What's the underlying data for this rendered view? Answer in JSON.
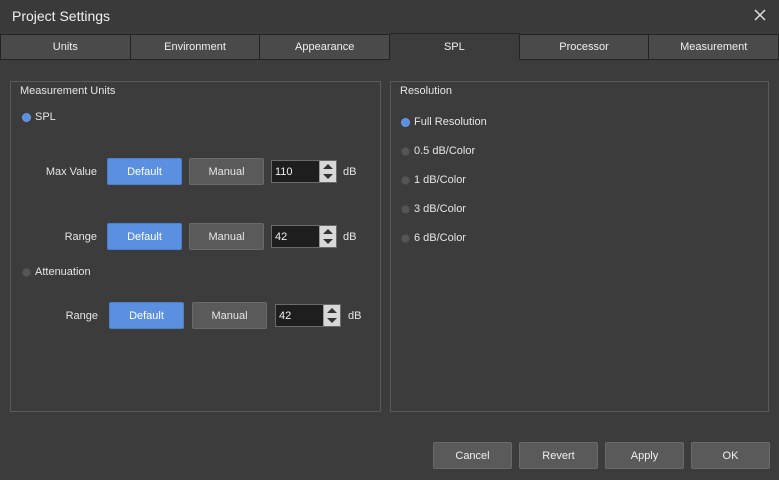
{
  "window": {
    "title": "Project Settings",
    "close_icon": "close-icon"
  },
  "tabs": [
    {
      "label": "Units"
    },
    {
      "label": "Environment"
    },
    {
      "label": "Appearance"
    },
    {
      "label": "SPL",
      "active": true
    },
    {
      "label": "Processor"
    },
    {
      "label": "Measurement"
    }
  ],
  "measurement_units": {
    "title": "Measurement Units",
    "spl_label": "SPL",
    "spl_selected": true,
    "max_value": {
      "label": "Max Value",
      "default_label": "Default",
      "manual_label": "Manual",
      "value": "110",
      "unit": "dB"
    },
    "spl_range": {
      "label": "Range",
      "default_label": "Default",
      "manual_label": "Manual",
      "value": "42",
      "unit": "dB"
    },
    "attenuation_label": "Attenuation",
    "attenuation_selected": false,
    "attenuation_range": {
      "label": "Range",
      "default_label": "Default",
      "manual_label": "Manual",
      "value": "42",
      "unit": "dB"
    }
  },
  "resolution": {
    "title": "Resolution",
    "options": [
      {
        "label": "Full Resolution",
        "selected": true
      },
      {
        "label": "0.5 dB/Color",
        "selected": false
      },
      {
        "label": "1 dB/Color",
        "selected": false
      },
      {
        "label": "3 dB/Color",
        "selected": false
      },
      {
        "label": "6 dB/Color",
        "selected": false
      }
    ]
  },
  "footer": {
    "cancel": "Cancel",
    "revert": "Revert",
    "apply": "Apply",
    "ok": "OK"
  },
  "colors": {
    "accent": "#5b8fe0",
    "background": "#3c3c3c",
    "button": "#5a5a5a"
  }
}
